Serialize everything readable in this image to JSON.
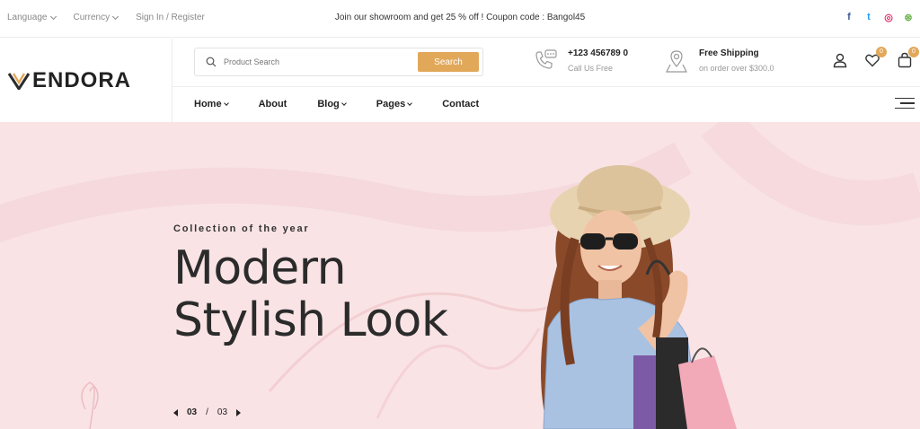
{
  "topbar": {
    "language": "Language",
    "currency": "Currency",
    "signin": "Sign In / Register",
    "promo": "Join our showroom and get 25 % off ! Coupon code : Bangol45",
    "social": [
      {
        "icon": "facebook-icon",
        "glyph": "f",
        "color": "#3b5998"
      },
      {
        "icon": "twitter-icon",
        "glyph": "t",
        "color": "#1da1f2"
      },
      {
        "icon": "instagram-icon",
        "glyph": "◎",
        "color": "#e1306c"
      },
      {
        "icon": "dribbble-icon",
        "glyph": "⊛",
        "color": "#6ab04c"
      }
    ]
  },
  "logo": {
    "text": "ENDORA",
    "accent": "#e2a85a"
  },
  "search": {
    "placeholder": "Product Search",
    "button": "Search"
  },
  "contact": {
    "phone": "+123 456789 0",
    "phone_sub": "Call Us Free"
  },
  "shipping": {
    "title": "Free Shipping",
    "sub": "on order over $300.0"
  },
  "actions": {
    "wishlist_count": "0",
    "cart_count": "0"
  },
  "nav": {
    "items": [
      {
        "label": "Home",
        "dropdown": true
      },
      {
        "label": "About",
        "dropdown": false
      },
      {
        "label": "Blog",
        "dropdown": true
      },
      {
        "label": "Pages",
        "dropdown": true
      },
      {
        "label": "Contact",
        "dropdown": false
      }
    ]
  },
  "hero": {
    "eyebrow": "Collection of the year",
    "title_line1": "Modern",
    "title_line2": "Stylish Look",
    "pager_current": "03",
    "pager_sep": "/",
    "pager_total": "03"
  }
}
